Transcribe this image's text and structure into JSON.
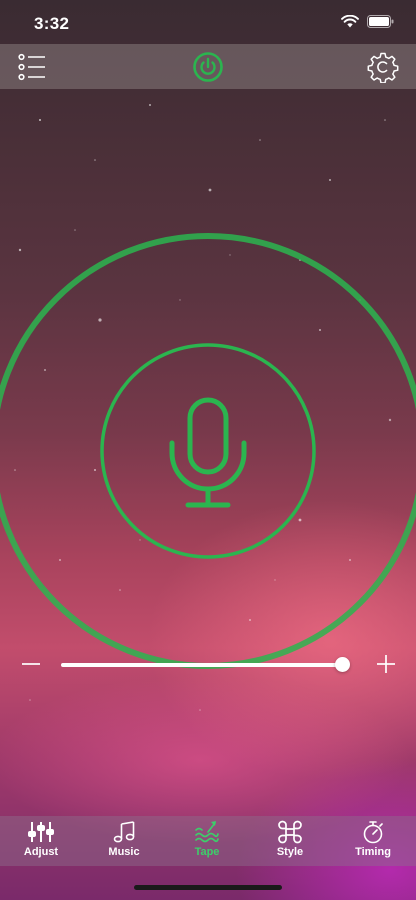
{
  "status_bar": {
    "time": "3:32"
  },
  "colors": {
    "accent": "#2bb54f",
    "tab_active": "#3ccf6a"
  },
  "toolbar": {
    "menu_icon": "list-icon",
    "power_icon": "power-icon",
    "settings_icon": "gear-icon"
  },
  "volume": {
    "level": 0.98
  },
  "tabs": [
    {
      "label": "Adjust",
      "icon": "sliders-icon",
      "active": false
    },
    {
      "label": "Music",
      "icon": "music-note-icon",
      "active": false
    },
    {
      "label": "Tape",
      "icon": "tape-icon",
      "active": true
    },
    {
      "label": "Style",
      "icon": "command-icon",
      "active": false
    },
    {
      "label": "Timing",
      "icon": "timer-icon",
      "active": false
    }
  ]
}
